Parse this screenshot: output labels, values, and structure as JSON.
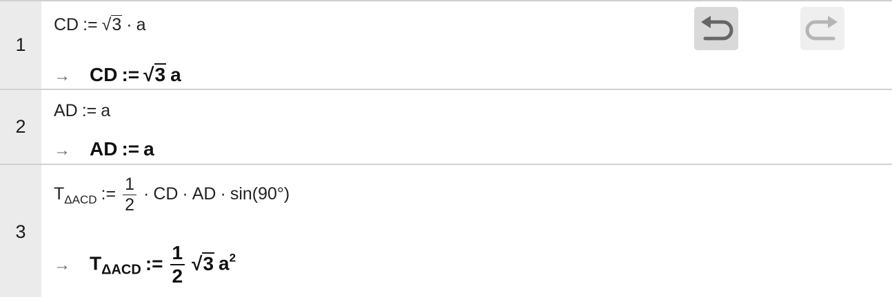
{
  "toolbar": {
    "undo_icon": "undo-icon",
    "redo_icon": "redo-icon"
  },
  "rows": [
    {
      "number": "1",
      "input": {
        "lhs": "CD",
        "assign": ":=",
        "radicand": "3",
        "dot": "·",
        "var": "a"
      },
      "output": {
        "arrow": "→",
        "lhs": "CD",
        "assign": ":=",
        "radicand": "3",
        "var": "a"
      }
    },
    {
      "number": "2",
      "input": {
        "lhs": "AD",
        "assign": ":=",
        "rhs": "a"
      },
      "output": {
        "arrow": "→",
        "lhs": "AD",
        "assign": ":=",
        "rhs": "a"
      }
    },
    {
      "number": "3",
      "input": {
        "lhs": "T",
        "lhs_sub": "ΔACD",
        "assign": ":=",
        "num": "1",
        "den": "2",
        "dot": "·",
        "t1": "CD",
        "t2": "AD",
        "t3": "sin(90°)"
      },
      "output": {
        "arrow": "→",
        "lhs": "T",
        "lhs_sub": "ΔACD",
        "assign": ":=",
        "num": "1",
        "den": "2",
        "radicand": "3",
        "var": "a",
        "exp": "2"
      }
    }
  ],
  "colors": {
    "gutter": "#ebebeb",
    "separator": "#d0d0d0",
    "undo_bg": "#d9d9d9",
    "redo_bg": "#efefef",
    "undo_icon": "#666666",
    "redo_icon": "#b5b5b5"
  }
}
